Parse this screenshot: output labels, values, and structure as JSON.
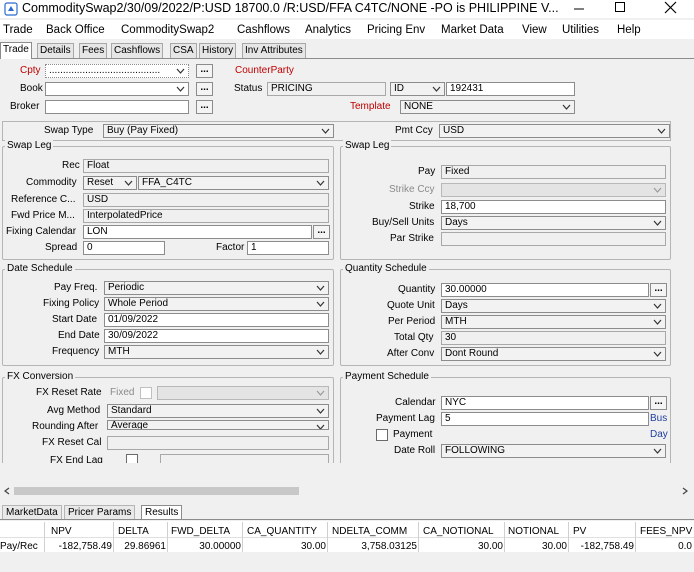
{
  "window": {
    "title": "CommoditySwap2/30/09/2022/P:USD 18700.0 /R:USD/FFA C4TC/NONE  -PO is PHILIPPINE V..."
  },
  "menu": [
    "Trade",
    "Back Office",
    "CommoditySwap2",
    "Cashflows",
    "Analytics",
    "Pricing Env",
    "Market Data",
    "View",
    "Utilities",
    "Help"
  ],
  "tabs": {
    "items": [
      "Trade",
      "Details",
      "Fees",
      "Cashflows",
      "CSA",
      "History",
      "Inv Attributes"
    ],
    "active": "Trade"
  },
  "header": {
    "cpty_label": "Cpty",
    "cpty_value": "........................................",
    "counterparty_label": "CounterParty",
    "book_label": "Book",
    "book_value": "",
    "status_label": "Status",
    "status_value": "PRICING",
    "id_combo": "ID",
    "id_value": "192431",
    "broker_label": "Broker",
    "broker_value": "",
    "template_label": "Template",
    "template_value": "NONE",
    "ellipsis": "...",
    "swap_type_label": "Swap Type",
    "swap_type_value": "Buy (Pay Fixed)",
    "pmt_ccy_label": "Pmt Ccy",
    "pmt_ccy_value": "USD"
  },
  "swap_leg_left": {
    "title": "Swap Leg",
    "rec_label": "Rec",
    "rec_value": "Float",
    "commodity_label": "Commodity",
    "commodity_combo": "Reset",
    "commodity_value": "FFA_C4TC",
    "reference_label": "Reference C...",
    "reference_value": "USD",
    "fwd_price_label": "Fwd Price M...",
    "fwd_price_value": "InterpolatedPrice",
    "fixing_calendar_label": "Fixing Calendar",
    "fixing_calendar_value": "LON",
    "spread_label": "Spread",
    "spread_value": "0",
    "factor_label": "Factor",
    "factor_value": "1"
  },
  "swap_leg_right": {
    "title": "Swap Leg",
    "pay_label": "Pay",
    "pay_value": "Fixed",
    "strike_ccy_label": "Strike Ccy",
    "strike_ccy_value": "",
    "strike_label": "Strike",
    "strike_value": "18,700",
    "buy_sell_units_label": "Buy/Sell Units",
    "buy_sell_units_value": "Days",
    "par_strike_label": "Par Strike",
    "par_strike_value": ""
  },
  "date_schedule": {
    "title": "Date Schedule",
    "pay_freq_label": "Pay Freq.",
    "pay_freq_value": "Periodic",
    "fixing_policy_label": "Fixing Policy",
    "fixing_policy_value": "Whole Period",
    "start_date_label": "Start Date",
    "start_date_value": "01/09/2022",
    "end_date_label": "End Date",
    "end_date_value": "30/09/2022",
    "frequency_label": "Frequency",
    "frequency_value": "MTH"
  },
  "quantity_schedule": {
    "title": "Quantity Schedule",
    "quantity_label": "Quantity",
    "quantity_value": "30.00000",
    "quote_unit_label": "Quote Unit",
    "quote_unit_value": "Days",
    "per_period_label": "Per Period",
    "per_period_value": "MTH",
    "total_qty_label": "Total Qty",
    "total_qty_value": "30",
    "after_conv_label": "After Conv",
    "after_conv_value": "Dont Round"
  },
  "fx_conversion": {
    "title": "FX Conversion",
    "fx_reset_rate_label": "FX Reset Rate",
    "fixed_label": "Fixed",
    "avg_method_label": "Avg Method",
    "avg_method_value": "Standard",
    "rounding_after_label": "Rounding After",
    "rounding_after_value": "Average",
    "fx_reset_cal_label": "FX Reset Cal",
    "fx_end_lag_label": "FX End Lag"
  },
  "payment_schedule": {
    "title": "Payment Schedule",
    "calendar_label": "Calendar",
    "calendar_value": "NYC",
    "payment_lag_label": "Payment Lag",
    "payment_lag_value": "5",
    "payment_lag_unit": "Bus",
    "payment_label": "Payment",
    "payment_unit": "Day",
    "date_roll_label": "Date Roll",
    "date_roll_value": "FOLLOWING"
  },
  "bottom_tabs": {
    "items": [
      "MarketData",
      "Pricer Params",
      "Results"
    ],
    "active": "Results"
  },
  "results": {
    "columns": [
      "NPV",
      "DELTA",
      "FWD_DELTA",
      "CA_QUANTITY",
      "NDELTA_COMM",
      "CA_NOTIONAL",
      "NOTIONAL",
      "PV",
      "FEES_NPV"
    ],
    "row_label": "Pay/Rec",
    "values": [
      "-182,758.49",
      "29.86961",
      "30.00000",
      "30.00",
      "3,758.03125",
      "30.00",
      "30.00",
      "-182,758.49",
      "0.0"
    ]
  },
  "colors": {
    "accent_red": "#c00000",
    "link_blue": "#1f3fa0",
    "panel_bg": "#f0f0f0"
  }
}
